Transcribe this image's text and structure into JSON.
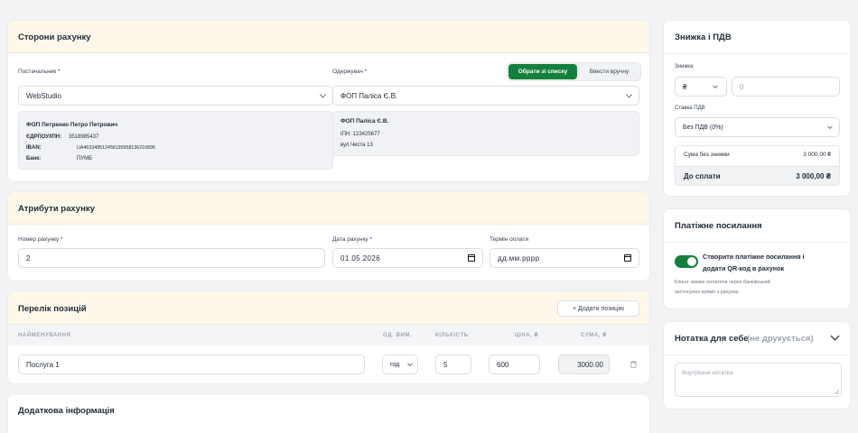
{
  "parties": {
    "title": "Сторони рахунку",
    "supplier_label": "Постачальник *",
    "supplier_value": "WebStudio",
    "recipient_label": "Одержувач *",
    "choose_from_list": "Обрати зі списку",
    "enter_manually": "Ввести вручну",
    "recipient_value": "ФОП Паліса Є.В.",
    "supplier_info": {
      "name": "ФОП Петренко Петро Петрович",
      "tax_label": "ЄДРПОУ/ІПН:",
      "tax_value": "3518985437",
      "iban_label": "IBAN:",
      "iban_value": "UA463348512458195958136216896",
      "bank_label": "Банк:",
      "bank_value": "ПУМБ"
    },
    "recipient_info": {
      "name": "ФОП Паліса Є.В.",
      "ipn": "ІПН: 123425677",
      "address": "вул.Чиста 13"
    }
  },
  "attributes": {
    "title": "Атрибути рахунку",
    "number_label": "Номер рахунку *",
    "number_value": "2",
    "date_label": "Дата рахунку *",
    "date_value": "01.05.2026",
    "due_label": "Термін оплати",
    "due_placeholder": "дд.мм.рррр"
  },
  "items": {
    "title": "Перелік позицій",
    "add_label": "+ Додати позицію",
    "columns": {
      "name": "НАЙМЕНУВАННЯ",
      "unit": "ОД. ВИМ.",
      "qty": "КІЛЬКІСТЬ",
      "price": "ЦІНА, ₴",
      "sum": "СУМА, ₴"
    },
    "rows": [
      {
        "name": "Послуга 1",
        "unit": "год",
        "qty": "5",
        "price": "600",
        "sum": "3000.00"
      }
    ]
  },
  "additional": {
    "title": "Додаткова інформація"
  },
  "discount": {
    "title": "Знижка і ПДВ",
    "discount_label": "Знижка",
    "currency": "₴",
    "discount_value": "0",
    "vat_label": "Ставка ПДВ",
    "vat_value": "Без ПДВ (0%)",
    "subtotal_label": "Сума без знижки",
    "subtotal_value": "3 000,00 ₴",
    "total_label": "До сплати",
    "total_value": "3 000,00 ₴"
  },
  "payment": {
    "title": "Платіжне посилання",
    "toggle_on": true,
    "toggle_label_1": "Створити платіжне посилання і",
    "toggle_label_2": "додати QR-код в рахунок",
    "hint_1": "Клієнт зможе оплатити через банківський",
    "hint_2": "застосунок прямо з рахунку."
  },
  "note": {
    "title": "Нотатка для себе",
    "title_suffix": "(не друкується)",
    "placeholder": "Внутрішня нотатка"
  },
  "colors": {
    "accent": "#15803d",
    "header_bg": "#fdf8ea",
    "page_bg": "#f3f3f5"
  }
}
